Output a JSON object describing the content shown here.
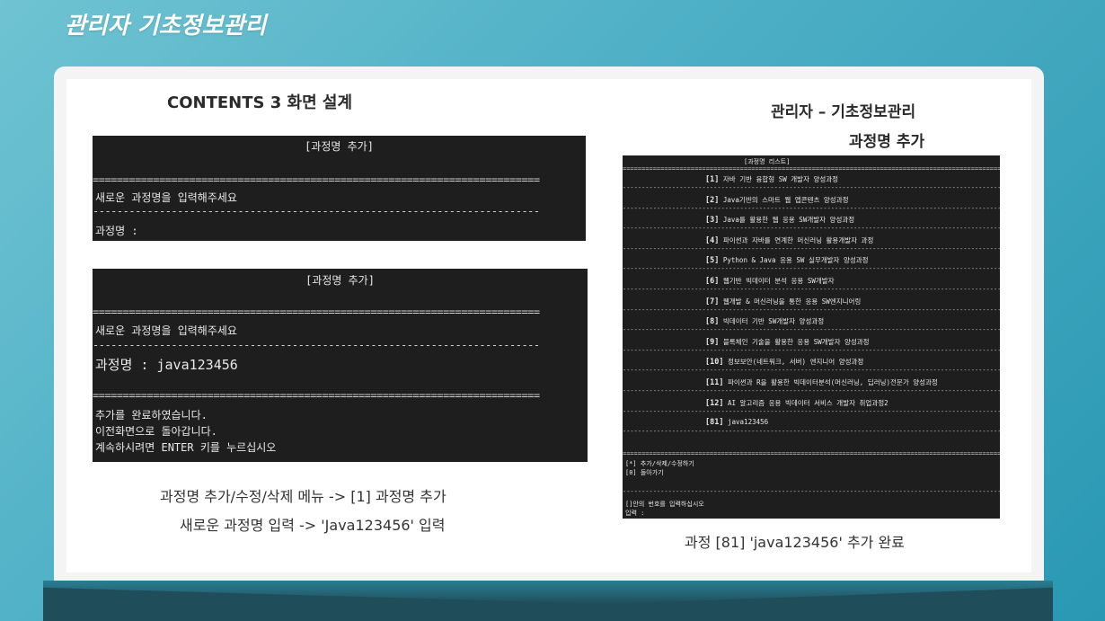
{
  "slide": {
    "title": "관리자 기초정보관리"
  },
  "left": {
    "heading": "CONTENTS 3 화면 설계",
    "term1": {
      "header": "[과정명 추가]",
      "rule_eq": "==========================================================================",
      "prompt": "새로운 과정명을 입력해주세요",
      "rule_dash": "--------------------------------------------------------------------------",
      "field": "과정명 :"
    },
    "term2": {
      "header": "[과정명 추가]",
      "rule_eq": "==========================================================================",
      "prompt": "새로운 과정명을 입력해주세요",
      "rule_dash": "--------------------------------------------------------------------------",
      "field": "과정명 : java123456",
      "msg1": "추가를 완료하였습니다.",
      "msg2": "이전화면으로 돌아갑니다.",
      "msg3": "계속하시려면 ENTER 키를 누르십시오"
    },
    "caption1": "과정명 추가/수정/삭제 메뉴 -> [1] 과정명 추가",
    "caption2": "새로운 과정명 입력  -> 'Java123456' 입력"
  },
  "right": {
    "heading1": "관리자 – 기초정보관리",
    "heading2": "과정명 추가",
    "term3": {
      "header": "[과정명 리스트]",
      "rule_eq": "=================================================================================================================",
      "rule_dash": "-----------------------------------------------------------------------------------------------------------------",
      "items": [
        {
          "num": "[1]",
          "text": "자바 기반 융합형 SW 개발자 양성과정"
        },
        {
          "num": "[2]",
          "text": "Java기반의 스마트 웹 앱콘텐츠 양성과정"
        },
        {
          "num": "[3]",
          "text": "Java를 활용한 웹 응용 SW개발자 양성과정"
        },
        {
          "num": "[4]",
          "text": "파이썬과 자바를 연계한 머신러닝 활용개발자 과정"
        },
        {
          "num": "[5]",
          "text": "Python & Java 응용 SW 실무개발자 양성과정"
        },
        {
          "num": "[6]",
          "text": "웹기반 빅데이터 분석 응용 SW개발자"
        },
        {
          "num": "[7]",
          "text": "웹개발 & 머신러닝을 통한 응용 SW엔지니어링"
        },
        {
          "num": "[8]",
          "text": "빅데이터 기반 SW개발자 양성과정"
        },
        {
          "num": "[9]",
          "text": "블록체인 기술을 활용한 응용 SW개발자 양성과정"
        },
        {
          "num": "[10]",
          "text": "정보보안(네트워크, 서버) 엔지니어 양성과정"
        },
        {
          "num": "[11]",
          "text": "파이썬과 R을 활용한 빅데이터분석(머신러닝, 딥러닝)전문가 양성과정"
        },
        {
          "num": "[12]",
          "text": "AI 알고리즘 응용 빅데이터 서비스 개발자 취업과정2"
        },
        {
          "num": "[81]",
          "text": "java123456"
        }
      ],
      "menu1": "[*] 추가/삭제/수정하기",
      "menu2": "[0] 돌아가기",
      "input_prompt": "[]안의 번호를 입력하십시오",
      "input_label": "입력 :"
    },
    "caption": "과정 [81] 'java123456' 추가 완료"
  }
}
